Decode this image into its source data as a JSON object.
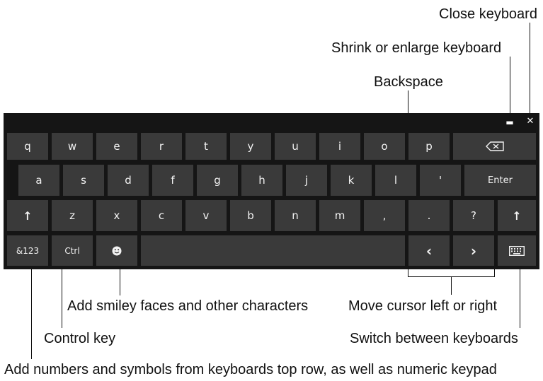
{
  "callouts": {
    "close_keyboard": "Close keyboard",
    "shrink_enlarge": "Shrink or enlarge keyboard",
    "backspace": "Backspace",
    "smiley": "Add smiley faces and other characters",
    "move_cursor": "Move cursor left or right",
    "control_key": "Control key",
    "switch_keyboards": "Switch between keyboards",
    "numbers_symbols": "Add numbers and  symbols from keyboards top row, as well as numeric keypad"
  },
  "keyboard": {
    "titlebar": {
      "shrink_icon": "▬",
      "close_icon": "✕"
    },
    "row1": [
      "q",
      "w",
      "e",
      "r",
      "t",
      "y",
      "u",
      "i",
      "o",
      "p"
    ],
    "row2": [
      "a",
      "s",
      "d",
      "f",
      "g",
      "h",
      "j",
      "k",
      "l",
      "'"
    ],
    "enter_label": "Enter",
    "shift_label": "↑",
    "row3": [
      "z",
      "x",
      "c",
      "v",
      "b",
      "n",
      "m",
      ",",
      ".",
      "?"
    ],
    "numsym_label": "&123",
    "ctrl_label": "Ctrl",
    "left_label": "‹",
    "right_label": "›"
  },
  "colors": {
    "keyboard_bg": "#151515",
    "key_bg": "#3a3a3a",
    "key_text": "#f2f2f2",
    "annotation_text": "#111111"
  }
}
